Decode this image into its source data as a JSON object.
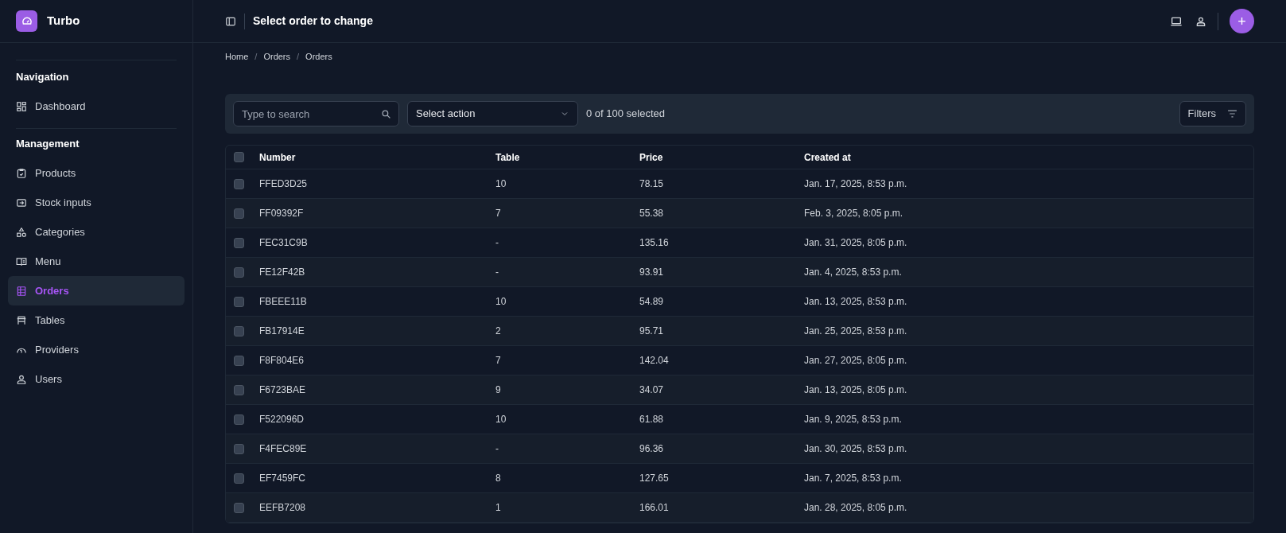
{
  "brand": "Turbo",
  "sidebar": {
    "sections": [
      {
        "title": "Navigation",
        "items": [
          {
            "label": "Dashboard",
            "selected": false
          }
        ]
      },
      {
        "title": "Management",
        "items": [
          {
            "label": "Products",
            "selected": false
          },
          {
            "label": "Stock inputs",
            "selected": false
          },
          {
            "label": "Categories",
            "selected": false
          },
          {
            "label": "Menu",
            "selected": false
          },
          {
            "label": "Orders",
            "selected": true
          },
          {
            "label": "Tables",
            "selected": false
          },
          {
            "label": "Providers",
            "selected": false
          },
          {
            "label": "Users",
            "selected": false
          }
        ]
      }
    ]
  },
  "header": {
    "title": "Select order to change",
    "add_button": "+"
  },
  "breadcrumbs": [
    {
      "kind": "link",
      "text": "Home"
    },
    {
      "kind": "separator",
      "text": "/"
    },
    {
      "kind": "link",
      "text": "Orders"
    },
    {
      "kind": "separator",
      "text": "/"
    },
    {
      "kind": "link",
      "text": "Orders"
    }
  ],
  "toolbar": {
    "search": {
      "placeholder": "Type to search"
    },
    "action": "Select action",
    "selection_count": "0 of 100 selected",
    "filters": "Filters"
  },
  "table": {
    "select_all_checked": false,
    "columns": [
      "Number",
      "Table",
      "Price",
      "Created at"
    ],
    "rows": [
      {
        "checked": false,
        "cells": [
          "FFED3D25",
          "10",
          "78.15",
          "Jan. 17, 2025, 8:53 p.m."
        ]
      },
      {
        "checked": false,
        "cells": [
          "FF09392F",
          "7",
          "55.38",
          "Feb. 3, 2025, 8:05 p.m."
        ]
      },
      {
        "checked": false,
        "cells": [
          "FEC31C9B",
          "-",
          "135.16",
          "Jan. 31, 2025, 8:05 p.m."
        ]
      },
      {
        "checked": false,
        "cells": [
          "FE12F42B",
          "-",
          "93.91",
          "Jan. 4, 2025, 8:53 p.m."
        ]
      },
      {
        "checked": false,
        "cells": [
          "FBEEE11B",
          "10",
          "54.89",
          "Jan. 13, 2025, 8:53 p.m."
        ]
      },
      {
        "checked": false,
        "cells": [
          "FB17914E",
          "2",
          "95.71",
          "Jan. 25, 2025, 8:53 p.m."
        ]
      },
      {
        "checked": false,
        "cells": [
          "F8F804E6",
          "7",
          "142.04",
          "Jan. 27, 2025, 8:05 p.m."
        ]
      },
      {
        "checked": false,
        "cells": [
          "F6723BAE",
          "9",
          "34.07",
          "Jan. 13, 2025, 8:05 p.m."
        ]
      },
      {
        "checked": false,
        "cells": [
          "F522096D",
          "10",
          "61.88",
          "Jan. 9, 2025, 8:53 p.m."
        ]
      },
      {
        "checked": false,
        "cells": [
          "F4FEC89E",
          "-",
          "96.36",
          "Jan. 30, 2025, 8:53 p.m."
        ]
      },
      {
        "checked": false,
        "cells": [
          "EF7459FC",
          "8",
          "127.65",
          "Jan. 7, 2025, 8:53 p.m."
        ]
      },
      {
        "checked": false,
        "cells": [
          "EEFB7208",
          "1",
          "166.01",
          "Jan. 28, 2025, 8:05 p.m."
        ]
      }
    ]
  }
}
